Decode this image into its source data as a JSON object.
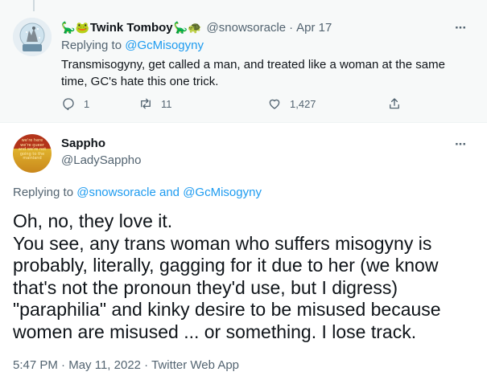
{
  "parent_tweet": {
    "display_name": "Twink Tomboy",
    "handle": "@snowsoracle",
    "date": "Apr 17",
    "replying_prefix": "Replying to",
    "replying_to": "@GcMisogyny",
    "text": "Transmisogyny, get called a man, and treated like a woman at the same time, GC's hate this one trick.",
    "replies": "1",
    "retweets": "11",
    "likes": "1,427",
    "more_label": "···",
    "separator": "·"
  },
  "main_tweet": {
    "display_name": "Sappho",
    "handle": "@LadySappho",
    "replying_prefix": "Replying to",
    "replying_to_1": "@snowsoracle",
    "replying_and": "and",
    "replying_to_2": "@GcMisogyny",
    "text": "Oh, no, they love it.\nYou see, any trans woman who suffers misogyny is probably, literally, gagging for it due to her (we know that's not the pronoun they'd use, but I digress) \"paraphilia\" and kinky desire to be misused because women are misused ... or something. I lose track.",
    "time": "5:47 PM",
    "date": "May 11, 2022",
    "source": "Twitter Web App",
    "more_label": "···",
    "separator": "·",
    "avatar_text": "we're here we're queer and we're not going to the mainland"
  },
  "colors": {
    "link": "#1d9bf0",
    "secondary_text": "#536471",
    "primary_text": "#0f1419",
    "parent_bg": "#f7f9f9"
  },
  "icons": {
    "reply": "reply-icon",
    "retweet": "retweet-icon",
    "like": "like-icon",
    "share": "share-icon",
    "more": "more-icon"
  }
}
